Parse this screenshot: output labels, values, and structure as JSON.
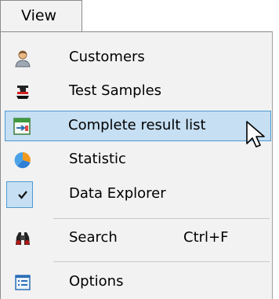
{
  "menubar": {
    "view_label": "View"
  },
  "menu": {
    "customers": "Customers",
    "test_samples": "Test Samples",
    "complete_result_list": "Complete result list",
    "statistic": "Statistic",
    "data_explorer": "Data Explorer",
    "search": "Search",
    "search_shortcut": "Ctrl+F",
    "options": "Options"
  },
  "state": {
    "highlighted_item": "Complete result list",
    "data_explorer_checked": true
  },
  "colors": {
    "menu_background": "#f2f2f2",
    "highlight_fill": "#c6dff3",
    "highlight_border": "#4f9ad2"
  }
}
